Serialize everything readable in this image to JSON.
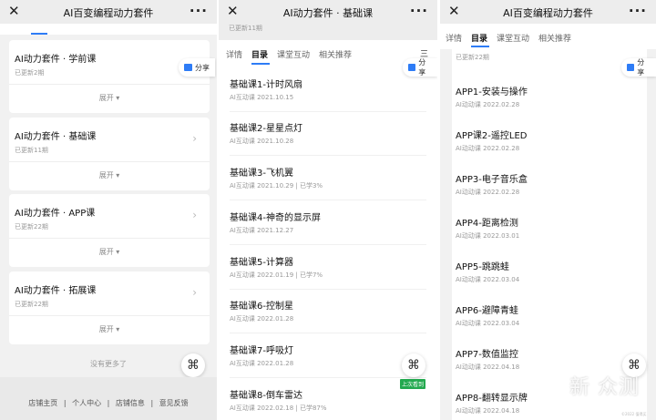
{
  "panel1": {
    "title": "AI百变编程动力套件",
    "close": "✕",
    "more": "···",
    "share": "分享",
    "courses": [
      {
        "title": "AI动力套件 · 学前课",
        "sub": "已更新2期",
        "expand": "展开 ▾"
      },
      {
        "title": "AI动力套件 · 基础课",
        "sub": "已更新11期",
        "expand": "展开 ▾"
      },
      {
        "title": "AI动力套件 · APP课",
        "sub": "已更新22期",
        "expand": "展开 ▾"
      },
      {
        "title": "AI动力套件 · 拓展课",
        "sub": "已更新22期",
        "expand": "展开 ▾"
      }
    ],
    "no_more": "没有更多了",
    "footer": [
      "店铺主页",
      "个人中心",
      "店铺信息",
      "意见反馈"
    ],
    "footer_sep": "|"
  },
  "panel2": {
    "title": "AI动力套件 · 基础课",
    "close": "✕",
    "more": "···",
    "updated": "已更新11期",
    "share": "分享",
    "tabs": [
      "详情",
      "目录",
      "课堂互动",
      "相关推荐"
    ],
    "tabs_icon": "三",
    "last_seen": "上次看到",
    "lessons": [
      {
        "title": "基础课1-计时风扇",
        "meta": "AI互动课  2021.10.15"
      },
      {
        "title": "基础课2-星星点灯",
        "meta": "AI互动课  2021.10.28"
      },
      {
        "title": "基础课3-飞机翼",
        "meta": "AI互动课  2021.10.29  |  已学3%"
      },
      {
        "title": "基础课4-神奇的显示屏",
        "meta": "AI互动课  2021.12.27"
      },
      {
        "title": "基础课5-计算器",
        "meta": "AI互动课  2022.01.19  |  已学7%"
      },
      {
        "title": "基础课6-控制星",
        "meta": "AI互动课  2022.01.28"
      },
      {
        "title": "基础课7-呼吸灯",
        "meta": "AI互动课  2022.01.28"
      },
      {
        "title": "基础课8-倒车雷达",
        "meta": "AI互动课  2022.02.18  |  已学87%"
      }
    ]
  },
  "panel3": {
    "title": "AI百变编程动力套件",
    "close": "✕",
    "more": "···",
    "updated": "已更新22期",
    "share": "分享",
    "tabs": [
      "详情",
      "目录",
      "课堂互动",
      "相关推荐"
    ],
    "lessons": [
      {
        "title": "APP1-安装与操作",
        "meta": "AI动动课  2022.02.28"
      },
      {
        "title": "APP课2-遥控LED",
        "meta": "AI动动课  2022.02.28"
      },
      {
        "title": "APP3-电子音乐盒",
        "meta": "AI动动课  2022.02.28"
      },
      {
        "title": "APP4-距离检测",
        "meta": "AI动动课  2022.03.01"
      },
      {
        "title": "APP5-跳跳蛙",
        "meta": "AI动动课  2022.03.04"
      },
      {
        "title": "APP6-避障青蛙",
        "meta": "AI动动课  2022.03.04"
      },
      {
        "title": "APP7-数值监控",
        "meta": "AI动动课  2022.04.18"
      },
      {
        "title": "APP8-翻转显示牌",
        "meta": "AI动动课  2022.04.18"
      }
    ],
    "watermark": "新 众测",
    "wm_small": "©2022 值得买"
  },
  "fab_icon": "⌘",
  "colors": {
    "accent": "#2e7cf6",
    "badge": "#23a94f"
  }
}
